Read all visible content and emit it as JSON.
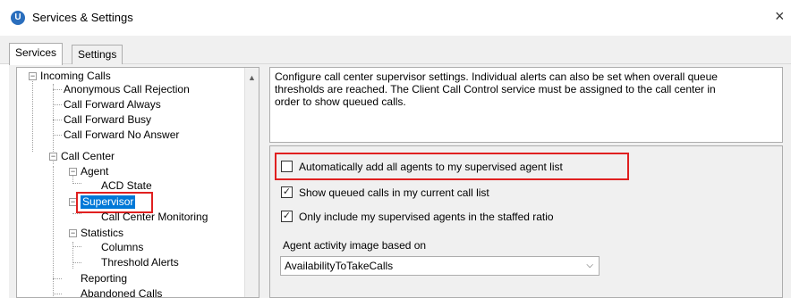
{
  "window": {
    "title": "Services & Settings",
    "close_glyph": "×",
    "logo_letter": "U"
  },
  "tabs": [
    {
      "label": "Services",
      "active": true
    },
    {
      "label": "Settings",
      "active": false
    }
  ],
  "tree": {
    "incoming_calls": "Incoming Calls",
    "anonymous_call_rejection": "Anonymous Call Rejection",
    "call_forward_always": "Call Forward Always",
    "call_forward_busy": "Call Forward Busy",
    "call_forward_no_answer": "Call Forward No Answer",
    "call_center": "Call Center",
    "agent": "Agent",
    "acd_state": "ACD State",
    "supervisor": "Supervisor",
    "call_center_monitoring": "Call Center Monitoring",
    "statistics": "Statistics",
    "columns": "Columns",
    "threshold_alerts": "Threshold Alerts",
    "reporting": "Reporting",
    "abandoned_calls": "Abandoned Calls",
    "expand_glyph": "−",
    "scroll_up_glyph": "▲"
  },
  "description": {
    "line1": "Configure call center supervisor settings.  Individual alerts can also be set when overall queue",
    "line2": "thresholds are reached.  The Client Call Control service must be assigned to the call center in",
    "line3": "order to show queued calls."
  },
  "settings": {
    "auto_add_agents": {
      "label": "Automatically add all agents to my supervised agent list",
      "checked": false
    },
    "show_queued_calls": {
      "label": "Show queued calls in my current call list",
      "checked": true
    },
    "only_supervised_agents": {
      "label": "Only include my supervised agents in the staffed ratio",
      "checked": true
    },
    "agent_activity_label": "Agent activity image based on",
    "agent_activity_value": "AvailabilityToTakeCalls",
    "check_glyph": "✓",
    "combo_arrow_glyph": "⌵"
  },
  "colors": {
    "selection": "#0078d7",
    "highlight_box": "#e02020",
    "panel_bg": "#f0f0f0"
  }
}
